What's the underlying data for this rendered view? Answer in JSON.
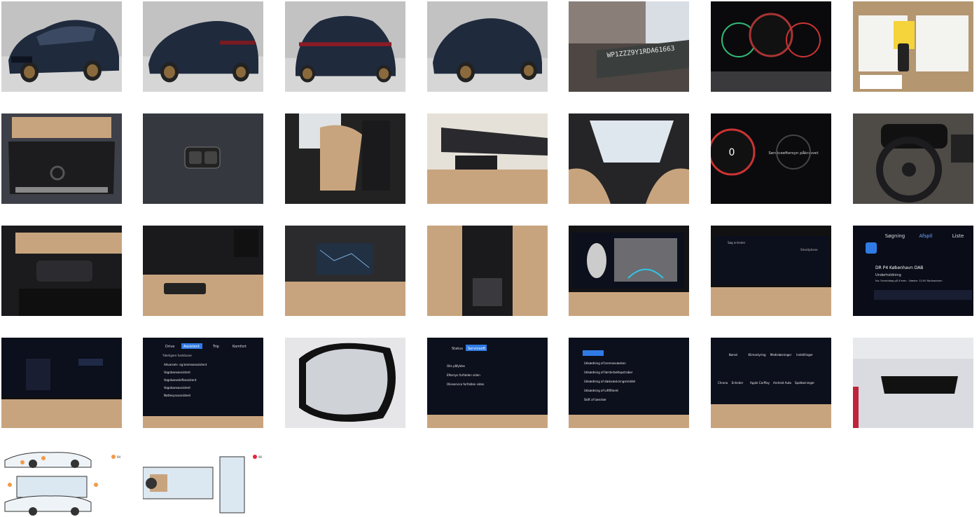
{
  "gallery": {
    "photos": [
      {
        "subject": "front-three-quarter"
      },
      {
        "subject": "rear-three-quarter-left"
      },
      {
        "subject": "rear"
      },
      {
        "subject": "front-three-quarter-right"
      },
      {
        "subject": "vin-plate",
        "vin_text": "WP1ZZZ9Y1RDA61663"
      },
      {
        "subject": "instrument-cluster"
      },
      {
        "subject": "service-papers-and-keys"
      },
      {
        "subject": "trunk"
      },
      {
        "subject": "seat-buttons"
      },
      {
        "subject": "rear-seats"
      },
      {
        "subject": "front-interior"
      },
      {
        "subject": "panorama-roof"
      },
      {
        "subject": "cluster-service-message",
        "message": "Serviceeftersyn påkrævet"
      },
      {
        "subject": "steering-wheel"
      },
      {
        "subject": "steering-column-stalk"
      },
      {
        "subject": "door-controls"
      },
      {
        "subject": "center-console-navigation"
      },
      {
        "subject": "center-tunnel"
      },
      {
        "subject": "reverse-camera"
      },
      {
        "subject": "device-connection-screen"
      },
      {
        "subject": "radio-screen"
      },
      {
        "subject": "phone-keypad-screen"
      },
      {
        "subject": "assistance-settings-screen"
      },
      {
        "subject": "side-mirror"
      },
      {
        "subject": "service-status-screen"
      },
      {
        "subject": "status-warnings-screen"
      },
      {
        "subject": "apps-screen"
      },
      {
        "subject": "rear-view-mirror"
      },
      {
        "subject": "damage-diagram-exterior"
      },
      {
        "subject": "damage-diagram-interior"
      }
    ]
  },
  "radio": {
    "tabs": [
      "Søgning",
      "Afspil",
      "Liste"
    ],
    "station": "DR P4 København DAB",
    "category": "Underholdning",
    "now_playing": "Nu: Formiddag på 4'eren - Næste: 12:00 Radioavisen"
  },
  "assistance": {
    "tabs": [
      "Drive",
      "Assistent",
      "Trip",
      "Komfort"
    ],
    "header": "Yderligere funktioner",
    "items": [
      "Advarsels- og bremseassistent",
      "Vognbaneassistent",
      "Vognbaneskiftassistent",
      "Vognbaneassistent",
      "Nattesynsassistent"
    ]
  },
  "service": {
    "tabs": [
      "Status",
      "Serviceeft."
    ],
    "items": [
      "Olie påfyldes",
      "Eftersyn forfalden siden",
      "Olieservice forfalden siden"
    ]
  },
  "status": {
    "items": [
      "Udsædning af bremsevæsken",
      "Udsædning af førsterbeltopstraber",
      "Udsædning af dækvæskningsmiddel",
      "Udsædning af luftfilteret",
      "Skift af tændrør"
    ]
  },
  "apps": {
    "labels": [
      "Kørsel",
      "Klimastyring",
      "Medieløsninger",
      "Indstillinger",
      "Chrono",
      "Enheder",
      "Apple CarPlay",
      "Android Auto",
      "Spotbeininger"
    ]
  },
  "connect": {
    "search_label": "Søg enheder",
    "device": "Smartphone"
  },
  "legend": {
    "exterior_count": "94",
    "interior_count": "90",
    "exterior_color": "#f39a4a",
    "interior_color": "#e3263a"
  },
  "colors": {
    "car_paint": "#1f2a3d",
    "wheel": "#8a6a3c",
    "studio_bg": "#b8b8b8",
    "leather": "#c8a47e",
    "screen_bg": "#0c0f1c",
    "accent_blue": "#2f7be6"
  }
}
